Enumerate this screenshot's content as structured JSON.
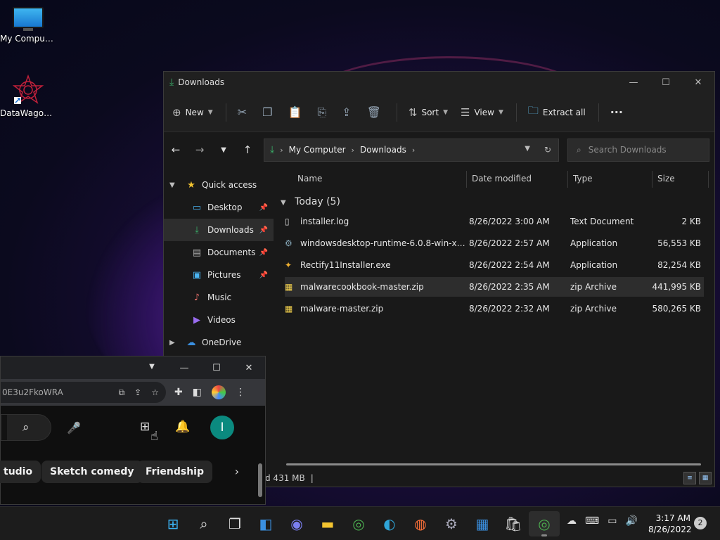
{
  "desktop": {
    "icons": [
      {
        "label": "My Computer",
        "icon": "monitor-icon"
      },
      {
        "label": "DataWagon...",
        "icon": "datawagon-logo-icon"
      }
    ]
  },
  "explorer": {
    "title": "Downloads",
    "toolbar": {
      "new_label": "New",
      "sort_label": "Sort",
      "view_label": "View",
      "extract_label": "Extract all"
    },
    "address": {
      "crumbs": [
        "My Computer",
        "Downloads"
      ]
    },
    "search": {
      "placeholder": "Search Downloads"
    },
    "nav": {
      "quick_access": "Quick access",
      "items": [
        {
          "label": "Desktop",
          "icon": "desktop-icon",
          "pinned": true
        },
        {
          "label": "Downloads",
          "icon": "download-icon",
          "pinned": true
        },
        {
          "label": "Documents",
          "icon": "document-icon",
          "pinned": true
        },
        {
          "label": "Pictures",
          "icon": "picture-icon",
          "pinned": true
        },
        {
          "label": "Music",
          "icon": "music-icon",
          "pinned": false
        },
        {
          "label": "Videos",
          "icon": "video-icon",
          "pinned": false
        }
      ],
      "onedrive": "OneDrive"
    },
    "columns": {
      "name": "Name",
      "date": "Date modified",
      "type": "Type",
      "size": "Size"
    },
    "group": "Today (5)",
    "files": [
      {
        "name": "installer.log",
        "date": "8/26/2022 3:00 AM",
        "type": "Text Document",
        "size": "2 KB",
        "icon": "text-file-icon"
      },
      {
        "name": "windowsdesktop-runtime-6.0.8-win-x64....",
        "date": "8/26/2022 2:57 AM",
        "type": "Application",
        "size": "56,553 KB",
        "icon": "installer-icon"
      },
      {
        "name": "Rectify11Installer.exe",
        "date": "8/26/2022 2:54 AM",
        "type": "Application",
        "size": "82,254 KB",
        "icon": "app-icon"
      },
      {
        "name": "malwarecookbook-master.zip",
        "date": "8/26/2022 2:35 AM",
        "type": "zip Archive",
        "size": "441,995 KB",
        "icon": "zip-icon"
      },
      {
        "name": "malware-master.zip",
        "date": "8/26/2022 2:32 AM",
        "type": "zip Archive",
        "size": "580,265 KB",
        "icon": "zip-icon"
      }
    ],
    "status": "d  431 MB"
  },
  "chrome": {
    "url_fragment": "0E3u2FkoWRA",
    "chips": [
      "tudio",
      "Sketch comedy",
      "Friendship"
    ],
    "avatar_letter": "I"
  },
  "taskbar": {
    "time": "3:17 AM",
    "date": "8/26/2022",
    "notifications": "2"
  }
}
